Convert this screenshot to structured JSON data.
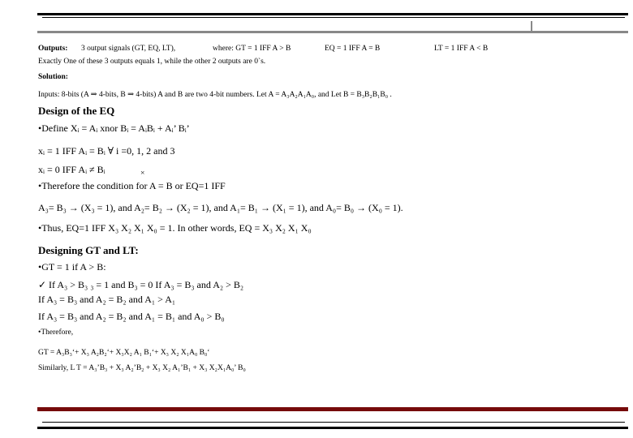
{
  "header": {
    "outputs_label": "Outputs:",
    "outputs_desc": "3 output signals (GT, EQ, LT),",
    "gt_def": "where: GT = 1 IFF  A > B",
    "eq_def": "EQ = 1 IFF A = B",
    "lt_def": "LT = 1 IFF A < B",
    "exactly": "Exactly One of these 3 outputs equals 1, while the other 2 outputs are 0`s.",
    "solution_label": "Solution:",
    "inputs": "Inputs: 8-bits (A ⇒ 4-bits, B ⇒ 4-bits) A and B are two 4-bit numbers. Let A = A₃A₂A₁A₀, and  Let B = B₃B₂B₁B₀ ."
  },
  "eq_section": {
    "title": "Design of the EQ",
    "define": "•Define  Xᵢ = Aᵢ xnor Bᵢ = AᵢBᵢ + Aᵢ’  Bᵢ’",
    "xi_one": "xᵢ = 1 IFF Aᵢ = Bᵢ ∀ i =0, 1, 2 and 3",
    "xi_zero": "xᵢ = 0 IFF Aᵢ ≠ Bᵢ",
    "mark": "×",
    "therefore": "•Therefore the condition for A = B or EQ=1 IFF",
    "conditions": "A₃= B₃ → (X₃ = 1), and  A₂= B₂ → (X₂ = 1), and  A₁= B₁ → (X₁ = 1), and  A₀= B₀ → (X₀ = 1).",
    "thus": "•Thus, EQ=1 IFF X₃ X₂ X₁ X₀ = 1. In other words, EQ = X₃ X₂ X₁   X₀"
  },
  "gt_lt_section": {
    "title": "Designing GT and LT:",
    "gt_if": "•GT = 1 if A > B:",
    "case1": "✓  If A₃ > B₃  ₃ = 1 and B₃ = 0  If A₃ = B₃ and A₂ > B₂",
    "case2": "If A₃ = B₃ and A₂ = B₂ and A₁ >  A₁",
    "case3": "If A₃ = B₃ and A₂ = B₂ and A₁ = B₁ and A₀   > B₀",
    "therefore": "•Therefore,",
    "gt_eq": "GT = A₃B₃‘+ X₃ A₂B₂‘+ X₃X₂ A₁ B₁‘+ X₃ X₂   X₁A₀  B₀‘",
    "lt_eq": "Similarly, L T = A₃’B₃ + X₃ A₂’B₂ + X₃ X₂ A₁’B₁ + X₃ X₂X₁A₀’ B₀"
  },
  "colors": {
    "bottom_rule": "#760a0a",
    "top_gray_rule": "#888888"
  }
}
